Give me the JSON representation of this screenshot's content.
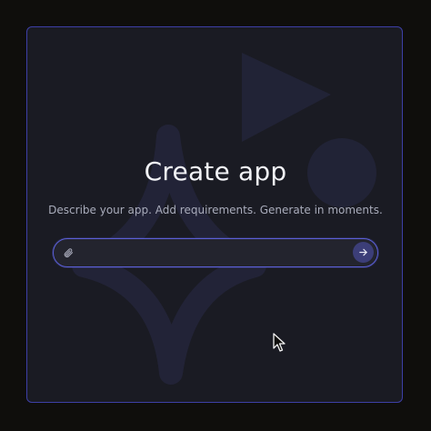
{
  "page": {
    "title": "Create app",
    "subtitle": "Describe your app. Add requirements. Generate in moments."
  },
  "prompt": {
    "value": "",
    "placeholder": "",
    "attach_icon": "paperclip-icon",
    "send_icon": "arrow-right-icon"
  },
  "colors": {
    "accent": "#5b5fd6",
    "panel_bg": "#1a1b23",
    "page_bg": "#0f0e0c",
    "title": "#f2f3f7",
    "subtitle": "#a9acbb"
  }
}
